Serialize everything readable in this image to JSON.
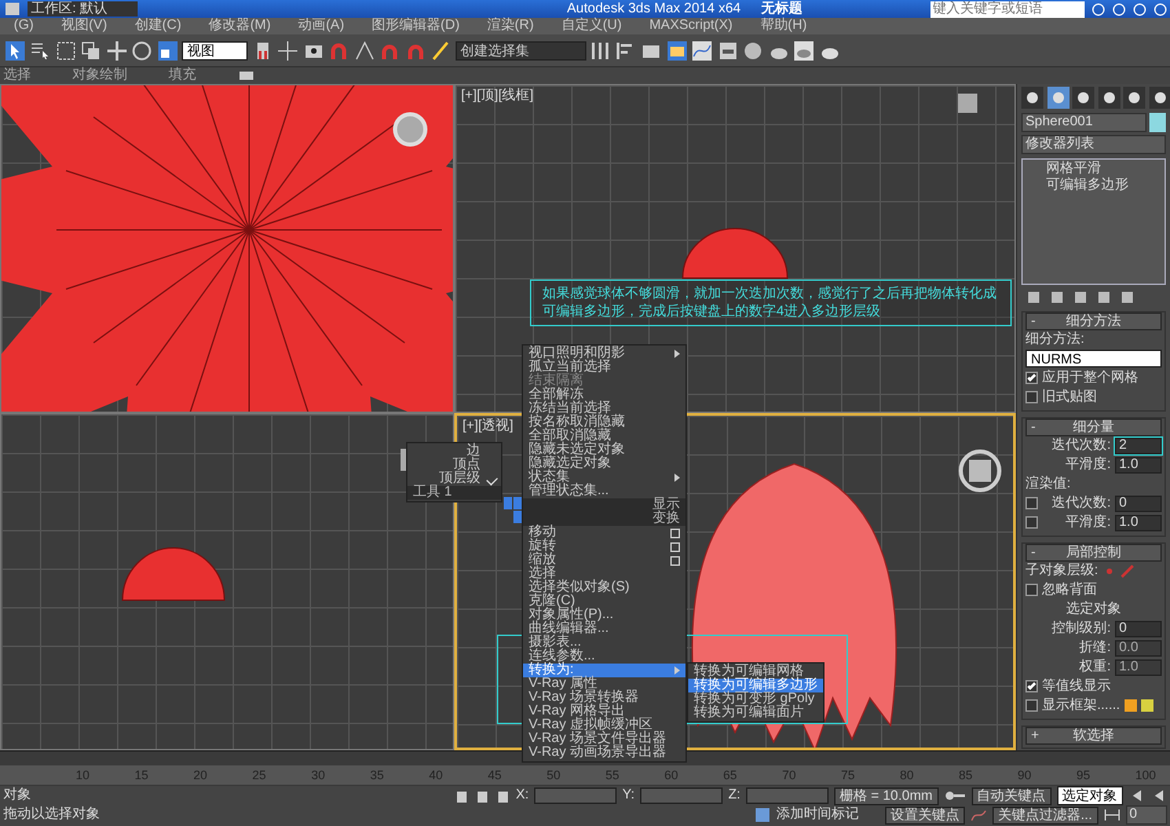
{
  "title_bar": {
    "workspace": "工作区: 默认",
    "app_title": "Autodesk 3ds Max  2014 x64",
    "document": "无标题",
    "search_placeholder": "键入关键字或短语"
  },
  "menu_bar": [
    "(G)",
    "视图(V)",
    "创建(C)",
    "修改器(M)",
    "动画(A)",
    "图形编辑器(D)",
    "渲染(R)",
    "自定义(U)",
    "MAXScript(X)",
    "帮助(H)"
  ],
  "toolbar": {
    "view_dropdown": "视图",
    "selection_set_dropdown": "创建选择集"
  },
  "ribbon_tabs": [
    "选择",
    "对象绘制",
    "填充"
  ],
  "viewports": [
    {
      "active": false
    },
    {
      "label": "[+][顶][线框]",
      "active": false
    },
    {
      "active": false
    },
    {
      "label": "[+][透视]",
      "active": true
    }
  ],
  "annotation": "如果感觉球体不够圆滑，就加一次迭加次数，感觉行了之后再把物体转化成可编辑多边形，完成后按键盘上的数字4进入多边形层级",
  "quad_menu": {
    "left_items": [
      {
        "label": "边",
        "checked": false
      },
      {
        "label": "顶点",
        "checked": false
      },
      {
        "label": "顶层级",
        "checked": true
      }
    ],
    "left_footer": "工具 1",
    "display_header": "显示",
    "transform_header": "变换",
    "display_items": [
      {
        "label": "视口照明和阴影",
        "submenu": true,
        "disabled": false
      },
      {
        "label": "孤立当前选择",
        "submenu": false,
        "disabled": false
      },
      {
        "label": "结束隔离",
        "submenu": false,
        "disabled": true
      },
      {
        "label": "全部解冻",
        "submenu": false,
        "disabled": false
      },
      {
        "label": "冻结当前选择",
        "submenu": false,
        "disabled": false
      },
      {
        "label": "按名称取消隐藏",
        "submenu": false,
        "disabled": false
      },
      {
        "label": "全部取消隐藏",
        "submenu": false,
        "disabled": false
      },
      {
        "label": "隐藏未选定对象",
        "submenu": false,
        "disabled": false
      },
      {
        "label": "隐藏选定对象",
        "submenu": false,
        "disabled": false
      },
      {
        "label": "状态集",
        "submenu": true,
        "disabled": false
      },
      {
        "label": "管理状态集...",
        "submenu": false,
        "disabled": false
      }
    ],
    "transform_items": [
      {
        "label": "移动",
        "submenu": false,
        "settings": true,
        "selected": false
      },
      {
        "label": "旋转",
        "submenu": false,
        "settings": true,
        "selected": false
      },
      {
        "label": "缩放",
        "submenu": false,
        "settings": true,
        "selected": false
      },
      {
        "label": "选择",
        "submenu": false,
        "settings": false,
        "selected": false
      },
      {
        "label": "选择类似对象(S)",
        "submenu": false,
        "settings": false,
        "selected": false
      },
      {
        "label": "克隆(C)",
        "submenu": false,
        "settings": false,
        "selected": false
      },
      {
        "label": "对象属性(P)...",
        "submenu": false,
        "settings": false,
        "selected": false
      },
      {
        "label": "曲线编辑器...",
        "submenu": false,
        "settings": false,
        "selected": false
      },
      {
        "label": "摄影表...",
        "submenu": false,
        "settings": false,
        "selected": false
      },
      {
        "label": "连线参数...",
        "submenu": false,
        "settings": false,
        "selected": false
      },
      {
        "label": "转换为:",
        "submenu": true,
        "settings": false,
        "selected": true
      },
      {
        "label": "V-Ray 属性",
        "submenu": false,
        "settings": false,
        "selected": false
      },
      {
        "label": "V-Ray 场景转换器",
        "submenu": false,
        "settings": false,
        "selected": false
      },
      {
        "label": "V-Ray 网格导出",
        "submenu": false,
        "settings": false,
        "selected": false
      },
      {
        "label": "V-Ray 虚拟帧缓冲区",
        "submenu": false,
        "settings": false,
        "selected": false
      },
      {
        "label": "V-Ray 场景文件导出器",
        "submenu": false,
        "settings": false,
        "selected": false
      },
      {
        "label": "V-Ray 动画场景导出器",
        "submenu": false,
        "settings": false,
        "selected": false
      }
    ],
    "submenu": [
      {
        "label": "转换为可编辑网格",
        "selected": false
      },
      {
        "label": "转换为可编辑多边形",
        "selected": true
      },
      {
        "label": "转换为可变形 gPoly",
        "selected": false
      },
      {
        "label": "转换为可编辑面片",
        "selected": false
      }
    ]
  },
  "command_panel": {
    "tabs": [
      {
        "selected": false
      },
      {
        "selected": true
      },
      {
        "selected": false
      },
      {
        "selected": false
      },
      {
        "selected": false
      },
      {
        "selected": false
      }
    ],
    "object_name": "Sphere001",
    "modifier_list": "修改器列表",
    "stack": [
      {
        "label": "网格平滑",
        "selected": false
      },
      {
        "label": "可编辑多边形",
        "selected": false
      }
    ],
    "rollouts": [
      {
        "sign": "-",
        "title": "细分方法",
        "rows": [
          {
            "kind": "label",
            "label": "细分方法:"
          },
          {
            "kind": "select",
            "value": "NURMS"
          },
          {
            "kind": "checkbox",
            "label": "应用于整个网格",
            "checked": true
          },
          {
            "kind": "checkbox",
            "label": "旧式贴图",
            "checked": false
          }
        ]
      },
      {
        "sign": "-",
        "title": "细分量",
        "rows": [
          {
            "kind": "spinner",
            "label": "迭代次数:",
            "value": "2",
            "highlighted": true,
            "disabled": false
          },
          {
            "kind": "spinner",
            "label": "平滑度:",
            "value": "1.0",
            "highlighted": false,
            "disabled": false
          },
          {
            "kind": "label",
            "label": "渲染值:"
          },
          {
            "kind": "check_spinner",
            "label": "迭代次数:",
            "value": "0",
            "checked": false
          },
          {
            "kind": "check_spinner",
            "label": "平滑度:",
            "value": "1.0",
            "checked": false
          }
        ]
      },
      {
        "sign": "-",
        "title": "局部控制",
        "rows": [
          {
            "kind": "levels",
            "label": "子对象层级:"
          },
          {
            "kind": "checkbox",
            "label": "忽略背面",
            "checked": false
          },
          {
            "kind": "center",
            "label": "选定对象"
          },
          {
            "kind": "spinner",
            "label": "控制级别:",
            "value": "0",
            "highlighted": false,
            "disabled": false
          },
          {
            "kind": "spinner",
            "label": "折缝:",
            "value": "0.0",
            "highlighted": false,
            "disabled": true
          },
          {
            "kind": "spinner",
            "label": "权重:",
            "value": "1.0",
            "highlighted": false,
            "disabled": true
          },
          {
            "kind": "checkbox",
            "label": "等值线显示",
            "checked": true
          },
          {
            "kind": "swatches",
            "label": "显示框架......",
            "checked": false,
            "swatches": [
              {
                "color": "#f0a020"
              },
              {
                "color": "#d8d040"
              }
            ]
          }
        ]
      },
      {
        "sign": "+",
        "title": "软选择"
      }
    ]
  },
  "timeline": {
    "ticks": [
      "10",
      "15",
      "20",
      "25",
      "30",
      "35",
      "40",
      "45",
      "50",
      "55",
      "60",
      "65",
      "70",
      "75",
      "80",
      "85",
      "90",
      "95",
      "100"
    ]
  },
  "status_bar": {
    "prompt_top": "对象",
    "prompt": "拖动以选择对象",
    "x_label": "X:",
    "y_label": "Y:",
    "z_label": "Z:",
    "grid": "栅格 = 10.0mm",
    "add_time_tag": "添加时间标记",
    "auto_key": "自动关键点",
    "set_key": "设置关键点",
    "selected_dropdown": "选定对象",
    "key_filters": "关键点过滤器...",
    "frame": "0"
  }
}
